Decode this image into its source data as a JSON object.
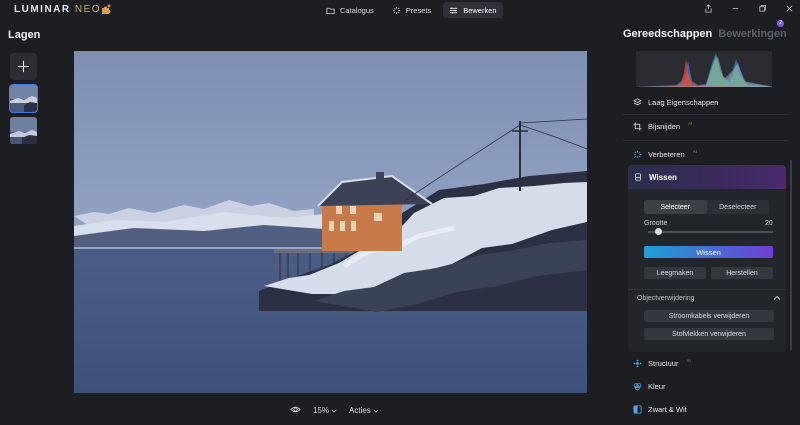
{
  "app": {
    "logo_main": "LUMINAR",
    "logo_sub": "NEO"
  },
  "nav": [
    {
      "label": "Catalogus",
      "icon": "folder-icon"
    },
    {
      "label": "Presets",
      "icon": "sparkle-icon"
    },
    {
      "label": "Bewerken",
      "icon": "sliders-icon",
      "active": true
    }
  ],
  "left": {
    "title": "Lagen"
  },
  "bottom": {
    "zoom": "15%",
    "actions": "Acties"
  },
  "right": {
    "tab_active": "Gereedschappen",
    "tab_inactive": "Bewerkingen",
    "badge": "2",
    "tools": {
      "layer_props": "Laag Eigenschappen",
      "crop": "Bijsnijden",
      "crop_badge": "AI",
      "enhance": "Verbeteren",
      "enhance_badge": "AI",
      "structure": "Structuur",
      "structure_badge": "AI",
      "color": "Kleur",
      "bw": "Zwart & Wit"
    },
    "wissen": {
      "title": "Wissen",
      "seg_select": "Selecteer",
      "seg_deselect": "Deselecteer",
      "size_label": "Grootte",
      "size_value": "20",
      "size_fraction": 0.08,
      "apply": "Wissen",
      "clear": "Leegmaken",
      "reset": "Herstellen",
      "object_section": "Objectverwijdering",
      "powerlines": "Stroomkabels verwijderen",
      "dust": "Stofvlekken verwijderen"
    }
  },
  "colors": {
    "accent_start": "#1e9fd6",
    "accent_end": "#6d3fd4",
    "selected_outline": "#3f7ee8"
  }
}
